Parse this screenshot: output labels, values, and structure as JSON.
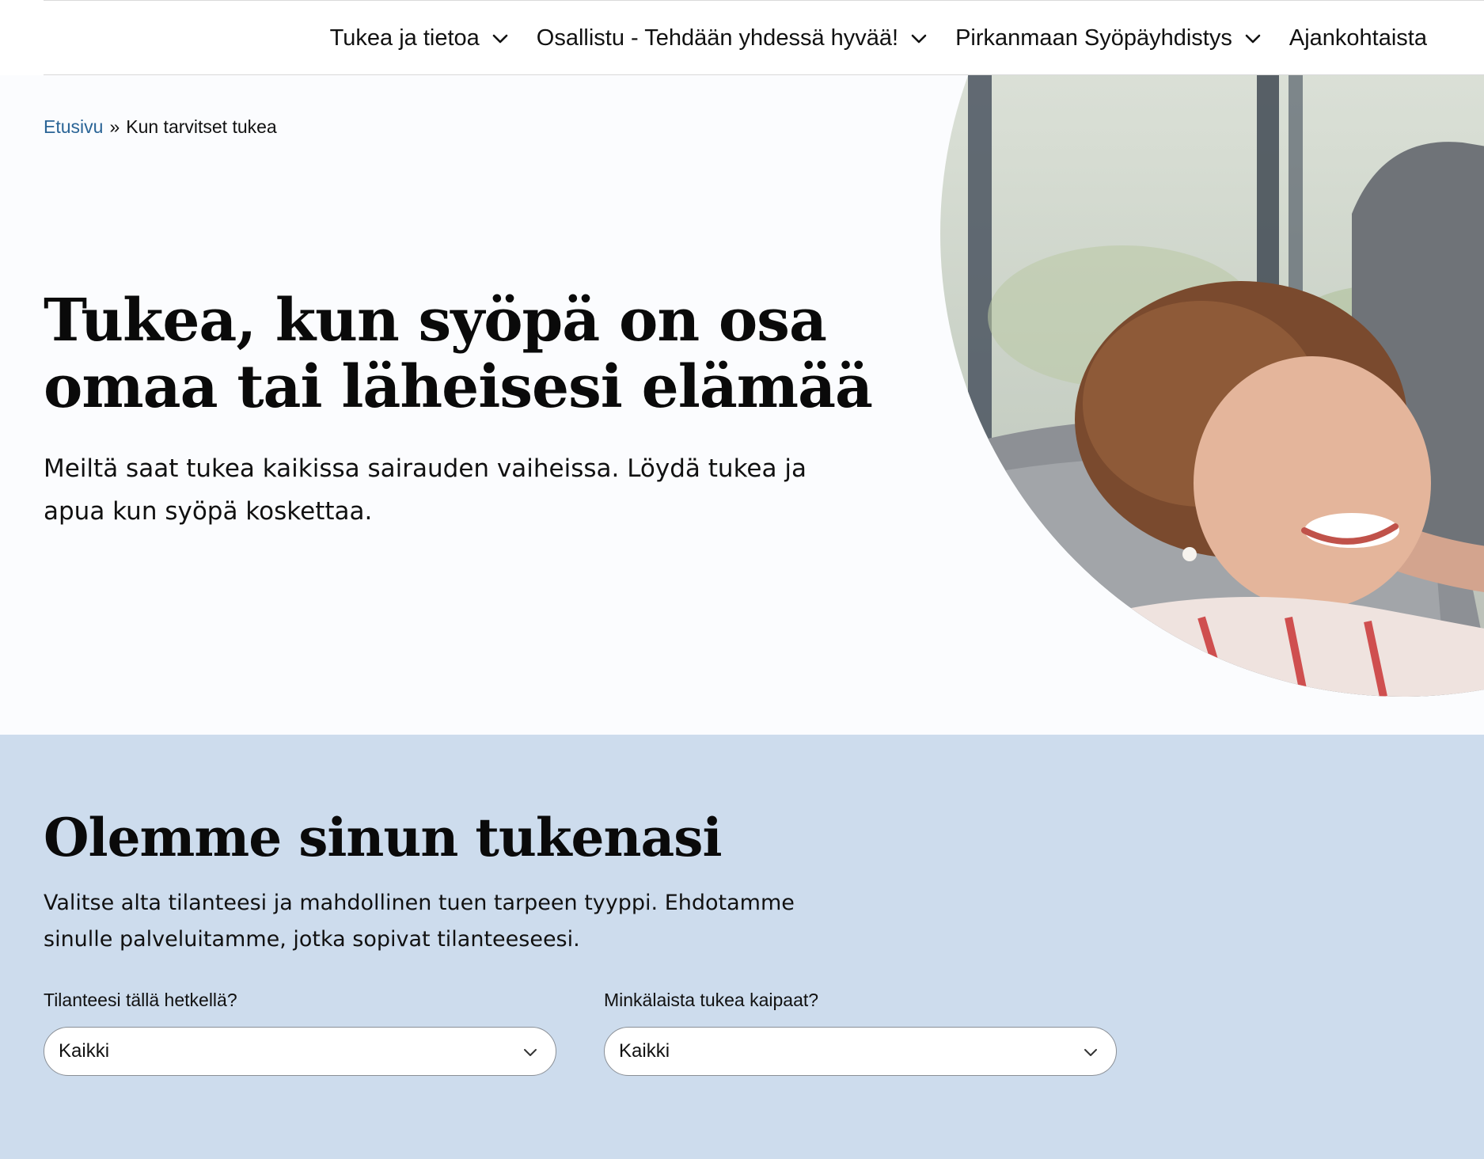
{
  "nav": {
    "items": [
      {
        "label": "Tukea ja tietoa",
        "has_dropdown": true
      },
      {
        "label": "Osallistu - Tehdään yhdessä hyvää!",
        "has_dropdown": true
      },
      {
        "label": "Pirkanmaan Syöpäyhdistys",
        "has_dropdown": true
      },
      {
        "label": "Ajankohtaista",
        "has_dropdown": false
      }
    ],
    "chevron_icon": "chevron-down-icon"
  },
  "breadcrumb": {
    "home": "Etusivu",
    "separator": "»",
    "current": "Kun tarvitset tukea"
  },
  "hero": {
    "title": "Tukea, kun syöpä on osa omaa tai läheisesi elämää",
    "lead": "Meiltä saat tukea kaikissa sairauden vaiheissa. Löydä tukea ja apua kun syöpä koskettaa."
  },
  "support": {
    "title": "Olemme sinun tukenasi",
    "lead": "Valitse alta tilanteesi ja mahdollinen tuen tarpeen tyyppi. Ehdotamme sinulle palveluitamme, jotka sopivat tilanteeseesi.",
    "filters": [
      {
        "label": "Tilanteesi tällä hetkellä?",
        "selected": "Kaikki"
      },
      {
        "label": "Minkälaista tukea kaipaat?",
        "selected": "Kaikki"
      }
    ]
  },
  "colors": {
    "link": "#2a6496",
    "hero_background": "#fbfcfe",
    "support_background": "#cddced",
    "text": "#111111"
  }
}
